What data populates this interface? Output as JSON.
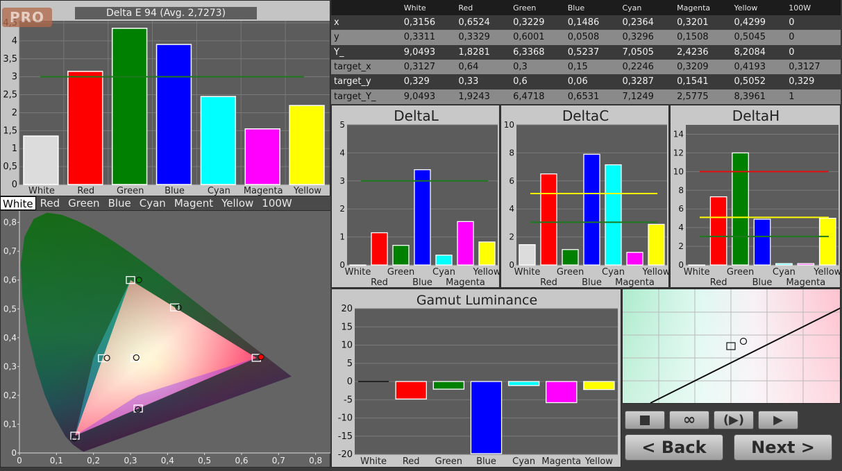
{
  "app": {
    "badge": "PRO"
  },
  "delta_e": {
    "title": "Delta E 94 (Avg. 2,7273)",
    "chart_data": {
      "type": "bar",
      "title": "Delta E 94 (Avg. 2,7273)",
      "categories": [
        "White",
        "Red",
        "Green",
        "Blue",
        "Cyan",
        "Magenta",
        "Yellow"
      ],
      "values": [
        1.35,
        3.15,
        4.35,
        3.9,
        2.45,
        1.55,
        2.2
      ],
      "colors": [
        "#dcdcdc",
        "#ff0000",
        "#008000",
        "#0000ff",
        "#00ffff",
        "#ff00ff",
        "#ffff00"
      ],
      "yticks": [
        "0",
        "0,5",
        "1",
        "1,5",
        "2",
        "2,5",
        "3",
        "3,5",
        "4",
        "4,5"
      ],
      "ylim": [
        0,
        4.5
      ],
      "threshold": 3,
      "threshold_color": "#1e7a1e"
    }
  },
  "tabs": [
    {
      "label": "White",
      "active": true
    },
    {
      "label": "Red",
      "active": false
    },
    {
      "label": "Green",
      "active": false
    },
    {
      "label": "Blue",
      "active": false
    },
    {
      "label": "Cyan",
      "active": false
    },
    {
      "label": "Magent",
      "active": false
    },
    {
      "label": "Yellow",
      "active": false
    },
    {
      "label": "100W",
      "active": false
    }
  ],
  "cie": {
    "chart_data": {
      "type": "scatter",
      "xticks": [
        "0",
        "0,1",
        "0,2",
        "0,3",
        "0,4",
        "0,5",
        "0,6",
        "0,7",
        "0,8"
      ],
      "yticks": [
        "0",
        "0,1",
        "0,2",
        "0,3",
        "0,4",
        "0,5",
        "0,6",
        "0,7",
        "0,8"
      ],
      "xlim": [
        0,
        0.84
      ],
      "ylim": [
        0,
        0.84
      ],
      "targets": [
        {
          "name": "Red",
          "x": 0.64,
          "y": 0.33
        },
        {
          "name": "Green",
          "x": 0.3,
          "y": 0.6
        },
        {
          "name": "Blue",
          "x": 0.15,
          "y": 0.06
        },
        {
          "name": "Cyan",
          "x": 0.2246,
          "y": 0.3287
        },
        {
          "name": "Magenta",
          "x": 0.3209,
          "y": 0.1541
        },
        {
          "name": "Yellow",
          "x": 0.4193,
          "y": 0.5052
        },
        {
          "name": "White",
          "x": 0.3127,
          "y": 0.329
        }
      ],
      "measured": [
        {
          "name": "Red",
          "x": 0.6524,
          "y": 0.3329
        },
        {
          "name": "Green",
          "x": 0.3229,
          "y": 0.6001
        },
        {
          "name": "Blue",
          "x": 0.1486,
          "y": 0.0508
        },
        {
          "name": "Cyan",
          "x": 0.2364,
          "y": 0.3296
        },
        {
          "name": "Magenta",
          "x": 0.3201,
          "y": 0.1508
        },
        {
          "name": "Yellow",
          "x": 0.4299,
          "y": 0.5045
        },
        {
          "name": "White",
          "x": 0.3156,
          "y": 0.3311
        }
      ]
    }
  },
  "table": {
    "columns": [
      "",
      "White",
      "Red",
      "Green",
      "Blue",
      "Cyan",
      "Magenta",
      "Yellow",
      "100W"
    ],
    "rows": [
      [
        "x",
        "0,3156",
        "0,6524",
        "0,3229",
        "0,1486",
        "0,2364",
        "0,3201",
        "0,4299",
        "0"
      ],
      [
        "y",
        "0,3311",
        "0,3329",
        "0,6001",
        "0,0508",
        "0,3296",
        "0,1508",
        "0,5045",
        "0"
      ],
      [
        "Y_",
        "9,0493",
        "1,8281",
        "6,3368",
        "0,5237",
        "7,0505",
        "2,4236",
        "8,2084",
        "0"
      ],
      [
        "target_x",
        "0,3127",
        "0,64",
        "0,3",
        "0,15",
        "0,2246",
        "0,3209",
        "0,4193",
        "0,3127"
      ],
      [
        "target_y",
        "0,329",
        "0,33",
        "0,6",
        "0,06",
        "0,3287",
        "0,1541",
        "0,5052",
        "0,329"
      ],
      [
        "target_Y_",
        "9,0493",
        "1,9243",
        "6,4718",
        "0,6531",
        "7,1249",
        "2,5775",
        "8,3961",
        "1"
      ]
    ]
  },
  "small_charts": [
    {
      "id": "deltaL",
      "title": "DeltaL",
      "chart_data": {
        "type": "bar",
        "title": "DeltaL",
        "categories": [
          "White",
          "Red",
          "Green",
          "Blue",
          "Cyan",
          "Magenta",
          "Yellow"
        ],
        "values": [
          0,
          1.15,
          0.7,
          3.4,
          0.35,
          1.55,
          0.82
        ],
        "yticks": [
          "0",
          "1",
          "2",
          "3",
          "4",
          "5"
        ],
        "ylim": [
          0,
          5
        ],
        "thresholds": [
          {
            "value": 3,
            "color": "#1e7a1e"
          }
        ]
      }
    },
    {
      "id": "deltaC",
      "title": "DeltaC",
      "chart_data": {
        "type": "bar",
        "title": "DeltaC",
        "categories": [
          "White",
          "Red",
          "Green",
          "Blue",
          "Cyan",
          "Magenta",
          "Yellow"
        ],
        "values": [
          1.45,
          6.5,
          1.1,
          7.9,
          7.15,
          0.9,
          2.9
        ],
        "yticks": [
          "0",
          "2",
          "4",
          "6",
          "8",
          "10"
        ],
        "ylim": [
          0,
          10
        ],
        "thresholds": [
          {
            "value": 5.1,
            "color": "#ffff00"
          },
          {
            "value": 3.05,
            "color": "#1e7a1e"
          }
        ]
      }
    },
    {
      "id": "deltaH",
      "title": "DeltaH",
      "chart_data": {
        "type": "bar",
        "title": "DeltaH",
        "categories": [
          "White",
          "Red",
          "Green",
          "Blue",
          "Cyan",
          "Magenta",
          "Yellow"
        ],
        "values": [
          0,
          7.3,
          12,
          4.9,
          0.15,
          0.15,
          5
        ],
        "yticks": [
          "0",
          "2",
          "4",
          "6",
          "8",
          "10",
          "12",
          "14"
        ],
        "ylim": [
          0,
          15
        ],
        "thresholds": [
          {
            "value": 10,
            "color": "#e01010"
          },
          {
            "value": 5.1,
            "color": "#ffff00"
          },
          {
            "value": 3.05,
            "color": "#1e7a1e"
          }
        ]
      }
    }
  ],
  "gamut_luminance": {
    "title": "Gamut Luminance",
    "chart_data": {
      "type": "bar",
      "title": "Gamut Luminance",
      "categories": [
        "White",
        "Red",
        "Green",
        "Blue",
        "Cyan",
        "Magenta",
        "Yellow"
      ],
      "values": [
        0,
        -4.8,
        -2.1,
        -19.8,
        -1.1,
        -5.8,
        -2.2
      ],
      "yticks": [
        "20",
        "15",
        "10",
        "5",
        "0",
        "-5",
        "-10",
        "-15",
        "-20"
      ],
      "ylim": [
        -20,
        20
      ]
    }
  },
  "colors": {
    "White": "#dcdcdc",
    "Red": "#ff0000",
    "Green": "#008000",
    "Blue": "#0000ff",
    "Cyan": "#00ffff",
    "Magenta": "#ff00ff",
    "Yellow": "#ffff00"
  },
  "controls": {
    "stop_icon": "stop-icon",
    "loop_icon": "infinity-icon",
    "play_continuous_icon": "play-circle-icon",
    "play_icon": "play-icon",
    "back_label": "< Back",
    "next_label": "Next  >"
  }
}
